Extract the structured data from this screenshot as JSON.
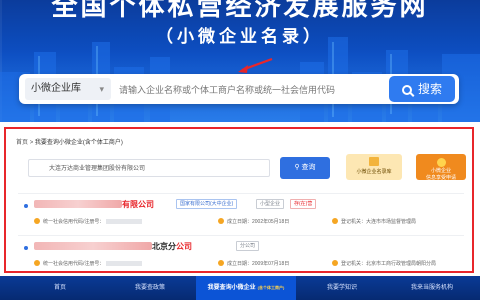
{
  "hero": {
    "title": "全国个体私营经济发展服务网",
    "subtitle": "（小微企业名录）"
  },
  "search": {
    "scope": "小微企业库",
    "placeholder": "请输入企业名称或个体工商户名称或统一社会信用代码",
    "button": "搜索"
  },
  "panel": {
    "breadcrumb_home": "首页",
    "breadcrumb_sep": ">",
    "breadcrumb_current": "我要查询小微企业(含个体工商户)",
    "inner_query": "大连万达商业管理集团股份有限公司",
    "inner_button": "查询",
    "card_list": "小微企业名录库",
    "card_apply_line1": "小微企业",
    "card_apply_line2": "信息享受申请"
  },
  "results": [
    {
      "name_suffix": "有限公司",
      "tags": [
        "国家有限公司(大中企业)",
        "小型企业",
        "存(在)营"
      ],
      "credit_label": "统一社会信用代码/注册号：",
      "date_label": "成立日期：2002年05月18日",
      "authority_label": "登记机关：大连市市场监督管理局"
    },
    {
      "name_prefix": "北京分",
      "name_suffix": "公司",
      "tags": [
        "分公司"
      ],
      "credit_label": "统一社会信用代码/注册号：",
      "date_label": "成立日期：2009年07月18日",
      "authority_label": "登记机关：北京市工商行政管理局朝阳分局"
    }
  ],
  "bottom_nav": {
    "items": [
      "首页",
      "我要查政策",
      "我要查询小微企业",
      "我要学知识",
      "我来当服务机构"
    ],
    "active_note": "(含个体工商户)"
  },
  "colors": {
    "brand_blue": "#0d4fc3",
    "highlight_red": "#e8262b",
    "accent_orange": "#f08a1e"
  }
}
